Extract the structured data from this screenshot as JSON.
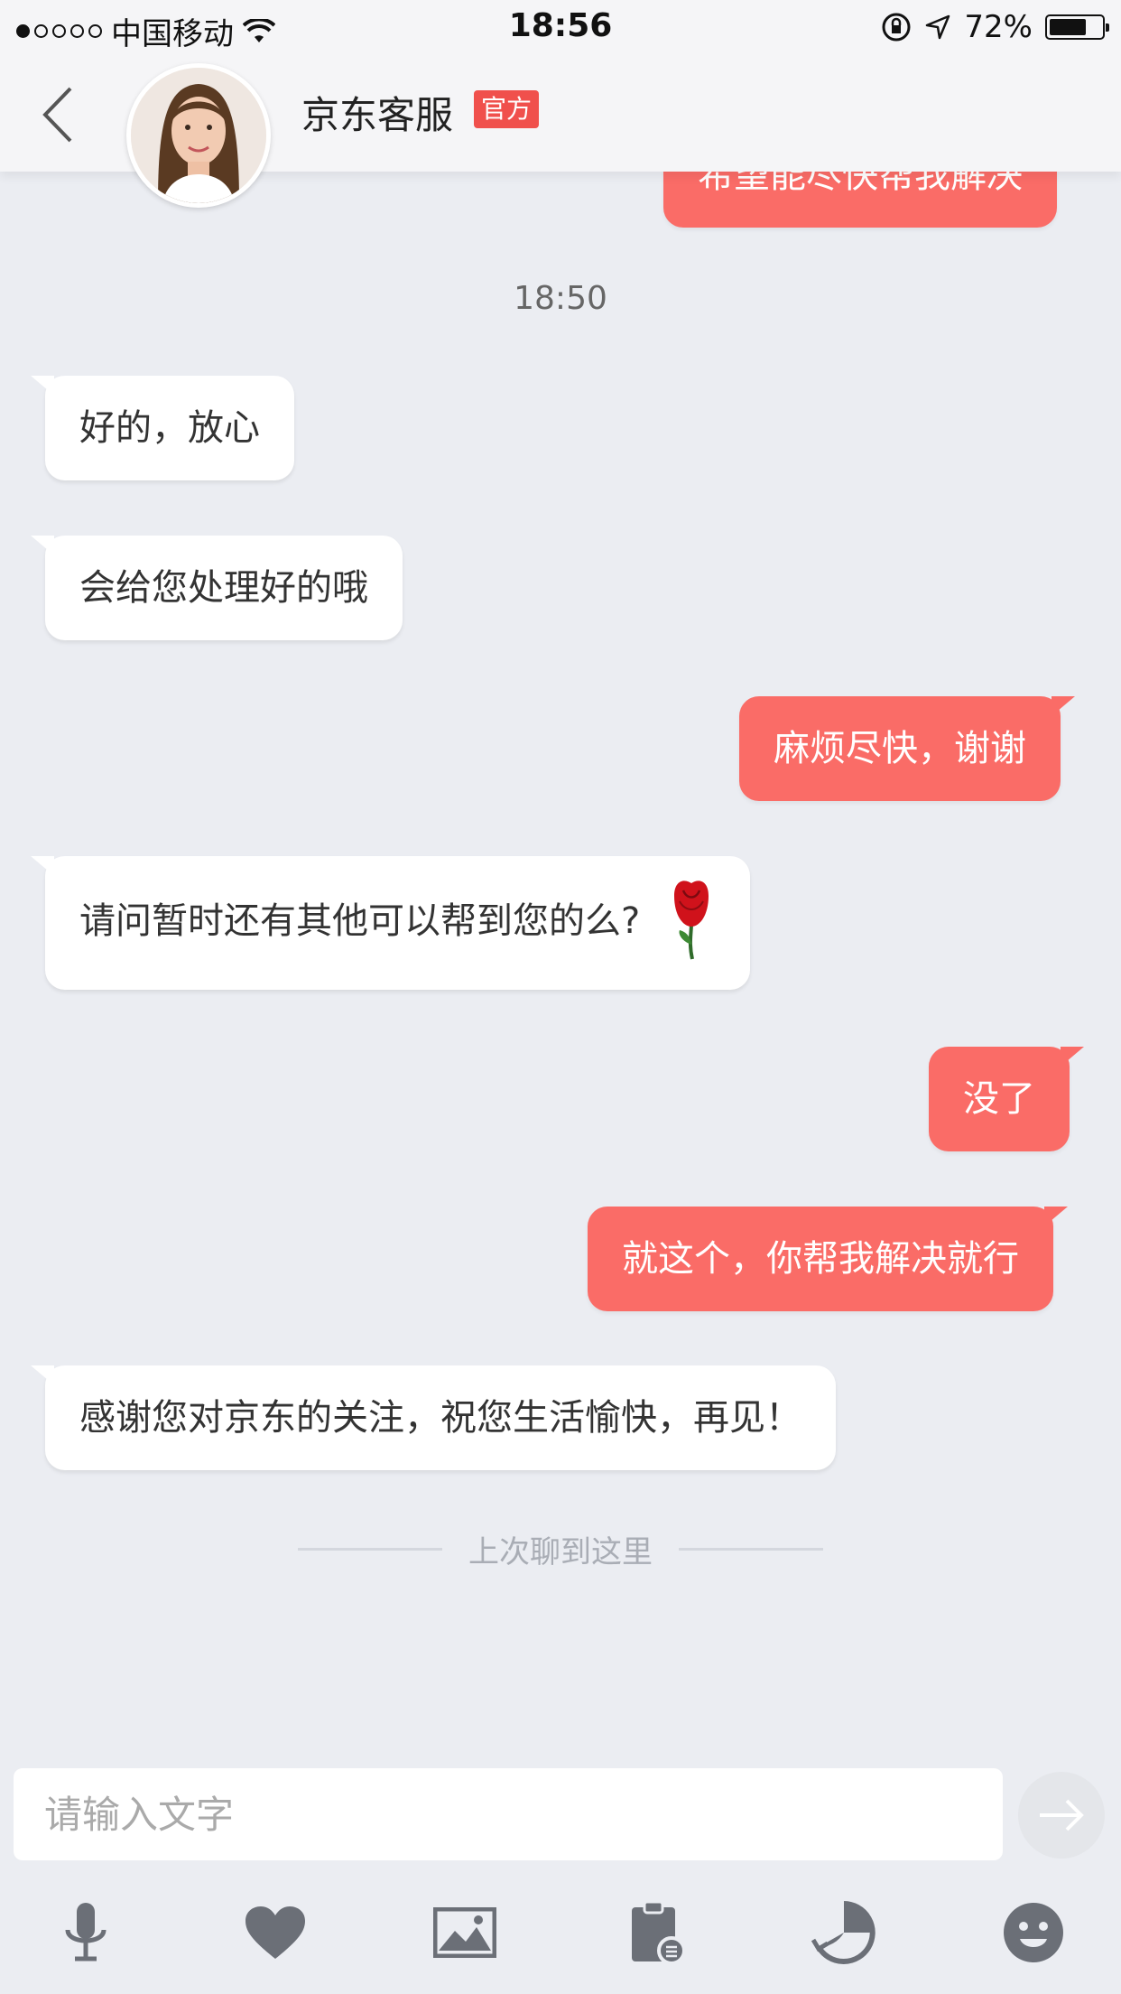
{
  "status_bar": {
    "carrier": "中国移动",
    "time": "18:56",
    "battery": "72%",
    "battery_level": 0.72
  },
  "header": {
    "title": "京东客服",
    "badge": "官方"
  },
  "chat": {
    "partial_top_message": "希望能尽快帮我解决",
    "timestamp": "18:50",
    "messages": [
      {
        "side": "left",
        "text": "好的，放心"
      },
      {
        "side": "left",
        "text": "会给您处理好的哦"
      },
      {
        "side": "right",
        "text": "麻烦尽快，谢谢"
      },
      {
        "side": "left",
        "text": "请问暂时还有其他可以帮到您的么?",
        "emoji": "rose-icon"
      },
      {
        "side": "right",
        "text": "没了"
      },
      {
        "side": "right",
        "text": "就这个，你帮我解决就行"
      },
      {
        "side": "left",
        "text": "感谢您对京东的关注，祝您生活愉快，再见！"
      }
    ],
    "divider": "上次聊到这里"
  },
  "input": {
    "placeholder": "请输入文字",
    "value": ""
  },
  "toolbar": {
    "icons": [
      "microphone-icon",
      "heart-icon",
      "image-icon",
      "clipboard-order-icon",
      "history-icon",
      "emoji-icon"
    ]
  },
  "colors": {
    "accent": "#fa6c67",
    "badge": "#f0504c",
    "background": "#ebedf2",
    "icon": "#6b6f77"
  }
}
